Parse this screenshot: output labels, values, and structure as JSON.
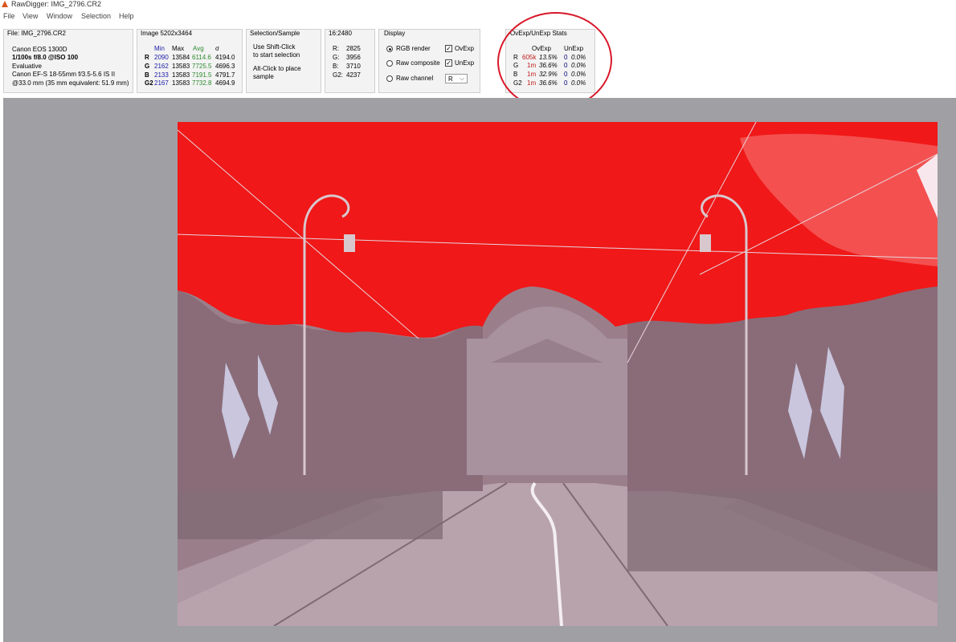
{
  "window": {
    "title": "RawDigger: IMG_2796.CR2"
  },
  "menu": [
    "File",
    "View",
    "Window",
    "Selection",
    "Help"
  ],
  "file_panel": {
    "title": "File: IMG_2796.CR2",
    "camera": "Canon EOS 1300D",
    "exposure": "1/100s f/8.0 @ISO 100",
    "metering": "Evaluative",
    "lens": "Canon EF-S 18-55mm f/3.5-5.6 IS II",
    "focal": "@33.0 mm (35 mm equivalent: 51.9 mm)"
  },
  "image_panel": {
    "title": "Image 5202x3464",
    "headers": {
      "min": "Min",
      "max": "Max",
      "avg": "Avg",
      "sigma": "σ"
    },
    "rows": [
      {
        "ch": "R",
        "min": "2090",
        "max": "13584",
        "avg": "6114.6",
        "sigma": "4194.0"
      },
      {
        "ch": "G",
        "min": "2162",
        "max": "13583",
        "avg": "7725.5",
        "sigma": "4696.3"
      },
      {
        "ch": "B",
        "min": "2133",
        "max": "13583",
        "avg": "7191.5",
        "sigma": "4791.7"
      },
      {
        "ch": "G2",
        "min": "2167",
        "max": "13583",
        "avg": "7732.8",
        "sigma": "4694.9"
      }
    ]
  },
  "selection_panel": {
    "title": "Selection/Sample",
    "line1": "Use Shift-Click",
    "line2": "to start selection",
    "line3": "Alt-Click to place",
    "line4": "sample"
  },
  "ratio_panel": {
    "title": "16:2480",
    "rows": [
      {
        "label": "R:",
        "value": "2825"
      },
      {
        "label": "G:",
        "value": "3956"
      },
      {
        "label": "B:",
        "value": "3710"
      },
      {
        "label": "G2:",
        "value": "4237"
      }
    ]
  },
  "display_panel": {
    "title": "Display",
    "rgb_render": "RGB render",
    "raw_composite": "Raw composite",
    "raw_channel": "Raw channel",
    "ovexp": "OvExp",
    "unexp": "UnExp",
    "channel_value": "R"
  },
  "stats_panel": {
    "title": "OvExp/UnExp Stats",
    "headers": {
      "ovexp": "OvExp",
      "unexp": "UnExp"
    },
    "rows": [
      {
        "ch": "R",
        "ov_count": "605k",
        "ov_pct": "13.5%",
        "un_count": "0",
        "un_pct": "0.0%"
      },
      {
        "ch": "G",
        "ov_count": "1m",
        "ov_pct": "36.6%",
        "un_count": "0",
        "un_pct": "0.0%"
      },
      {
        "ch": "B",
        "ov_count": "1m",
        "ov_pct": "32.9%",
        "un_count": "0",
        "un_pct": "0.0%"
      },
      {
        "ch": "G2",
        "ov_count": "1m",
        "ov_pct": "36.6%",
        "un_count": "0",
        "un_pct": "0.0%"
      }
    ]
  },
  "colors": {
    "overexposed": "#f01818",
    "overexposed_light": "#f45a5a",
    "tint": "#9a7f8a",
    "annotation": "#d8182a"
  }
}
